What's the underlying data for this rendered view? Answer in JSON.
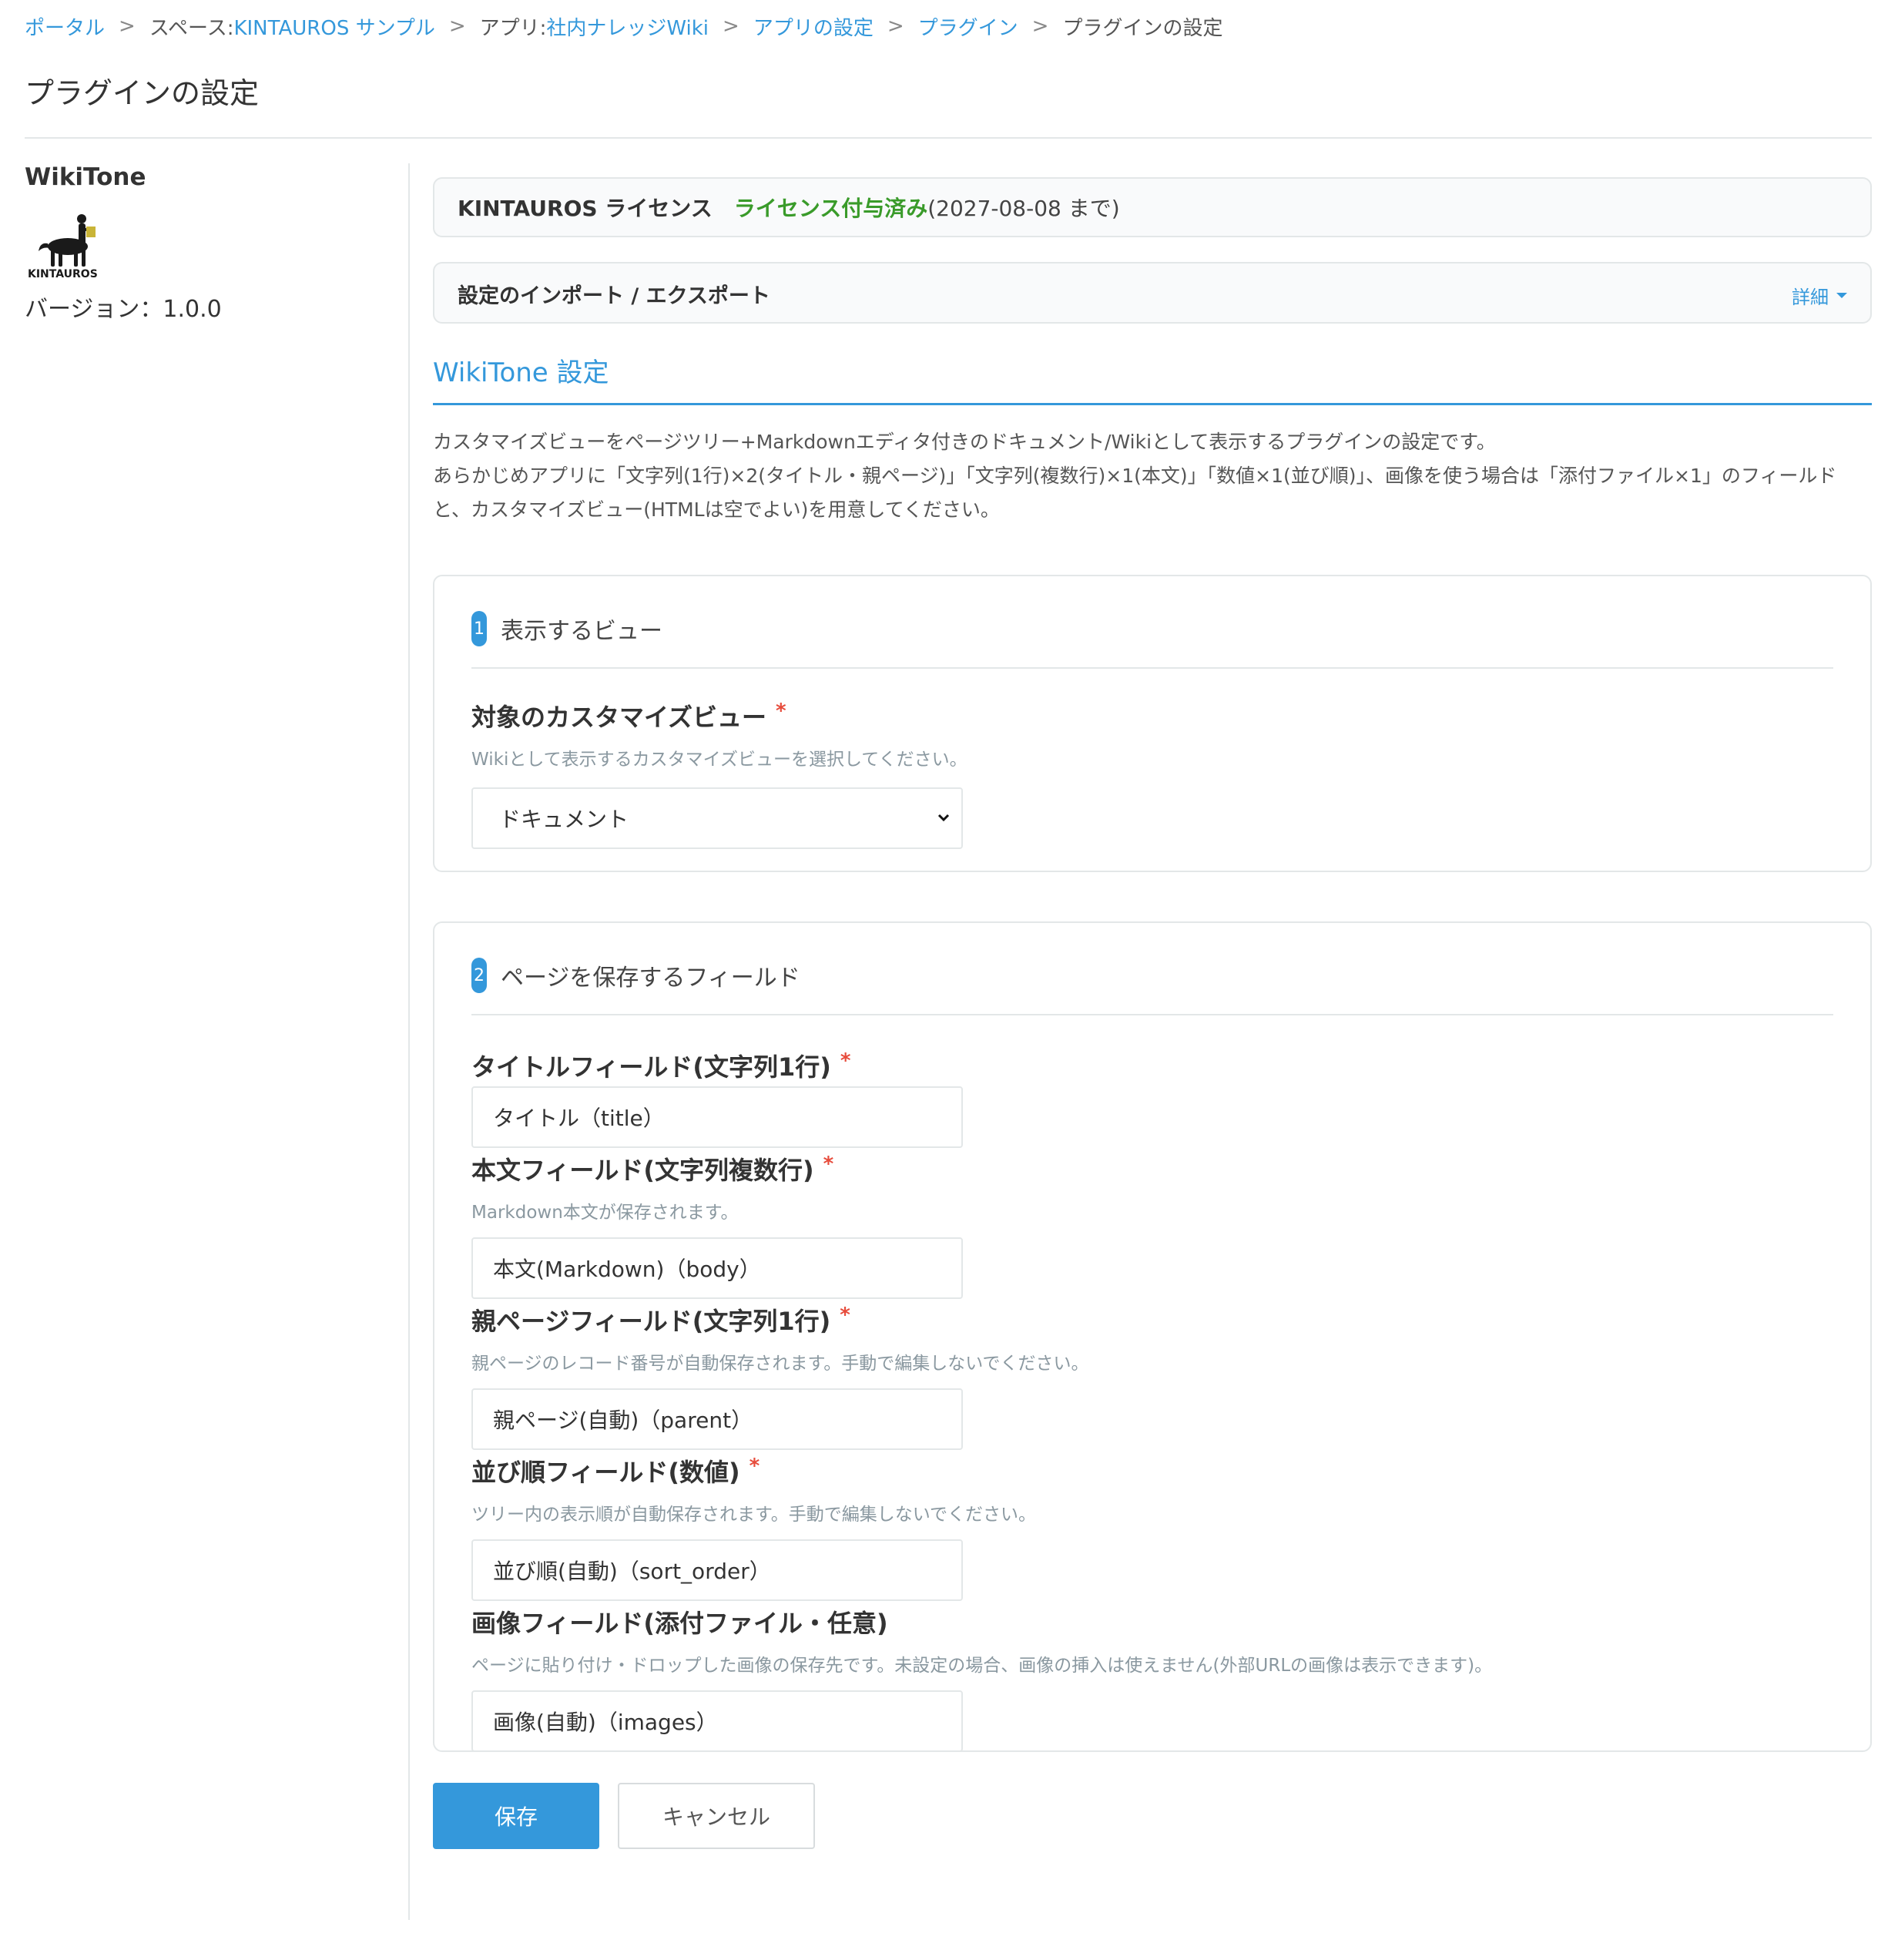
{
  "breadcrumb": {
    "portal": "ポータル",
    "sep": ">",
    "space_prefix": "スペース: ",
    "space_name": "KINTAUROS サンプル",
    "app_prefix": "アプリ: ",
    "app_name": "社内ナレッジWiki",
    "app_settings": "アプリの設定",
    "plugins": "プラグイン",
    "current": "プラグインの設定"
  },
  "page_title": "プラグインの設定",
  "sidebar": {
    "plugin_name": "WikiTone",
    "logo_text": "KINTAUROS",
    "version": "バージョン：1.0.0"
  },
  "license": {
    "label": "KINTAUROS ライセンス",
    "status": "ライセンス付与済み",
    "until": "(2027-08-08 まで)"
  },
  "import_export": {
    "label": "設定のインポート / エクスポート",
    "detail_link": "詳細"
  },
  "settings": {
    "heading": "WikiTone 設定",
    "desc_line1": "カスタマイズビューをページツリー+Markdownエディタ付きのドキュメント/Wikiとして表示するプラグインの設定です。",
    "desc_line2": "あらかじめアプリに「文字列(1行)×2(タイトル・親ページ)」「文字列(複数行)×1(本文)」「数値×1(並び順)」、画像を使う場合は「添付ファイル×1」のフィールド",
    "desc_line3": "と、カスタマイズビュー(HTMLは空でよい)を用意してください。"
  },
  "section1": {
    "number": "1",
    "title": "表示するビュー",
    "view_label": "対象のカスタマイズビュー",
    "view_hint": "Wikiとして表示するカスタマイズビューを選択してください。",
    "view_selected": "ドキュメント"
  },
  "section2": {
    "number": "2",
    "title": "ページを保存するフィールド",
    "required_mark": "*",
    "title_field_label": "タイトルフィールド(文字列1行)",
    "title_field_value": "タイトル（title）",
    "body_field_label": "本文フィールド(文字列複数行)",
    "body_field_hint": "Markdown本文が保存されます。",
    "body_field_value": "本文(Markdown)（body）",
    "parent_field_label": "親ページフィールド(文字列1行)",
    "parent_field_hint": "親ページのレコード番号が自動保存されます。手動で編集しないでください。",
    "parent_field_value": "親ページ(自動)（parent）",
    "order_field_label": "並び順フィールド(数値)",
    "order_field_hint": "ツリー内の表示順が自動保存されます。手動で編集しないでください。",
    "order_field_value": "並び順(自動)（sort_order）",
    "image_field_label": "画像フィールド(添付ファイル・任意)",
    "image_field_hint": "ページに貼り付け・ドロップした画像の保存先です。未設定の場合、画像の挿入は使えません(外部URLの画像は表示できます)。",
    "image_field_value": "画像(自動)（images）"
  },
  "buttons": {
    "save": "保存",
    "cancel": "キャンセル"
  },
  "colors": {
    "accent": "#3498db",
    "license_ok": "#3a9b2a",
    "required": "#e74c3c",
    "border": "#e3e7e8"
  }
}
